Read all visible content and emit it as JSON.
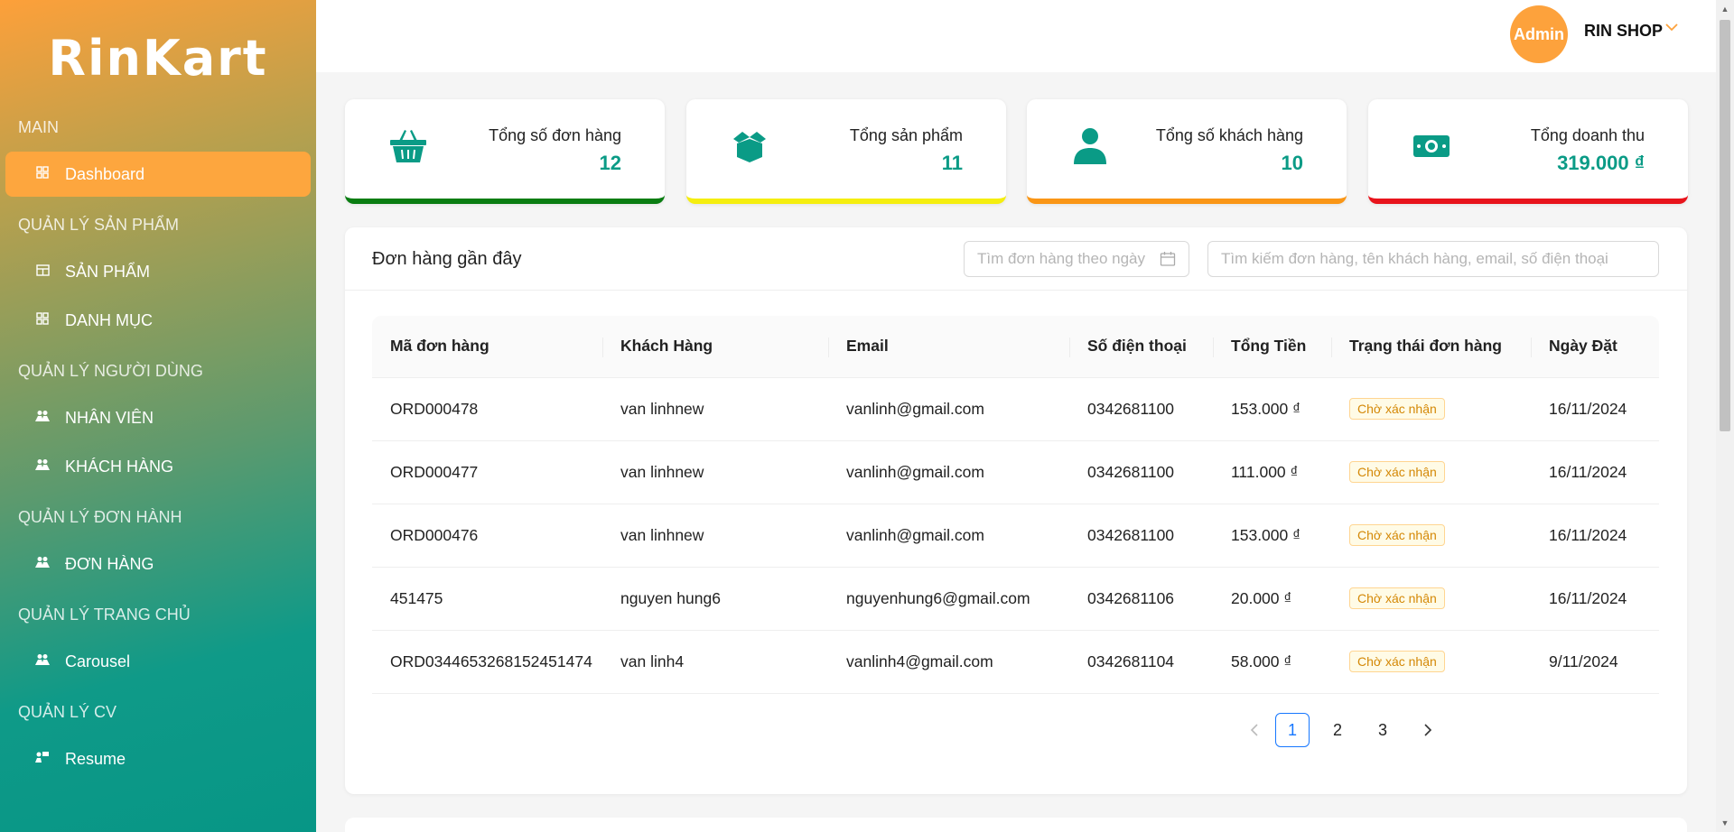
{
  "sidebar": {
    "logo": "RinKart",
    "sections": [
      {
        "title": "MAIN",
        "items": [
          {
            "label": "Dashboard",
            "icon": "grid-icon",
            "active": true
          }
        ]
      },
      {
        "title": "QUẢN LÝ SẢN PHẨM",
        "items": [
          {
            "label": "SẢN PHẨM",
            "icon": "store-icon"
          },
          {
            "label": "DANH MỤC",
            "icon": "grid-icon"
          }
        ]
      },
      {
        "title": "QUẢN LÝ NGƯỜI DÙNG",
        "items": [
          {
            "label": "NHÂN VIÊN",
            "icon": "users-icon"
          },
          {
            "label": "KHÁCH HÀNG",
            "icon": "users-icon"
          }
        ]
      },
      {
        "title": "QUẢN LÝ ĐƠN HÀNH",
        "items": [
          {
            "label": "ĐƠN HÀNG",
            "icon": "users-icon"
          }
        ]
      },
      {
        "title": "QUẢN LÝ TRANG CHỦ",
        "items": [
          {
            "label": "Carousel",
            "icon": "users-icon"
          }
        ]
      },
      {
        "title": "QUẢN LÝ CV",
        "items": [
          {
            "label": "Resume",
            "icon": "resume-icon"
          }
        ]
      }
    ]
  },
  "header": {
    "avatar": "Admin",
    "shop": "RIN SHOP"
  },
  "cards": [
    {
      "title": "Tổng số đơn hàng",
      "value": "12",
      "icon": "basket-icon",
      "color": "#0a7d12"
    },
    {
      "title": "Tổng sản phẩm",
      "value": "11",
      "icon": "box-icon",
      "color": "#f5ee0f"
    },
    {
      "title": "Tổng số khách hàng",
      "value": "10",
      "icon": "user-icon",
      "color": "#fa9616"
    },
    {
      "title": "Tổng doanh thu",
      "value": "319.000 ₫",
      "icon": "money-icon",
      "color": "#e8141c"
    }
  ],
  "orders": {
    "title": "Đơn hàng gần đây",
    "date_placeholder": "Tìm đơn hàng theo ngày",
    "search_placeholder": "Tìm kiếm đơn hàng, tên khách hàng, email, số điện thoại",
    "columns": [
      "Mã đơn hàng",
      "Khách Hàng",
      "Email",
      "Số điện thoại",
      "Tổng Tiền",
      "Trạng thái đơn hàng",
      "Ngày Đặt"
    ],
    "rows": [
      [
        "ORD000478",
        "van linhnew",
        "vanlinh@gmail.com",
        "0342681100",
        "153.000 ₫",
        "Chờ xác nhận",
        "16/11/2024"
      ],
      [
        "ORD000477",
        "van linhnew",
        "vanlinh@gmail.com",
        "0342681100",
        "111.000 ₫",
        "Chờ xác nhận",
        "16/11/2024"
      ],
      [
        "ORD000476",
        "van linhnew",
        "vanlinh@gmail.com",
        "0342681100",
        "153.000 ₫",
        "Chờ xác nhận",
        "16/11/2024"
      ],
      [
        "451475",
        "nguyen hung6",
        "nguyenhung6@gmail.com",
        "0342681106",
        "20.000 ₫",
        "Chờ xác nhận",
        "16/11/2024"
      ],
      [
        "ORD0344653268152451474",
        "van linh4",
        "vanlinh4@gmail.com",
        "0342681104",
        "58.000 ₫",
        "Chờ xác nhận",
        "9/11/2024"
      ]
    ],
    "pagination": {
      "pages": [
        "1",
        "2",
        "3"
      ],
      "current": "1"
    }
  }
}
